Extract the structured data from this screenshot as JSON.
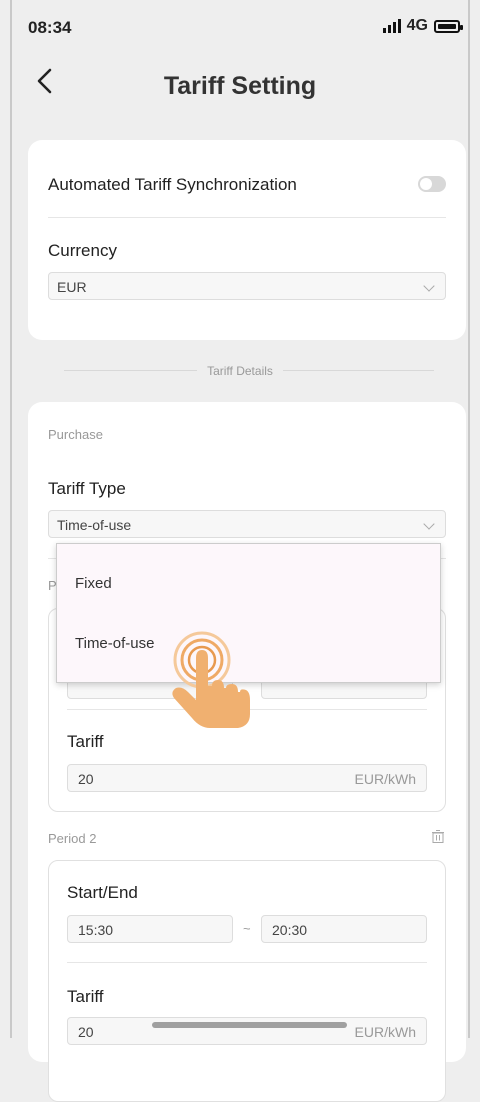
{
  "status_bar": {
    "time": "08:34",
    "network": "4G"
  },
  "header": {
    "back_icon": "chevron-left-icon",
    "title": "Tariff Setting"
  },
  "sync": {
    "label": "Automated Tariff Synchronization",
    "enabled": false
  },
  "currency": {
    "label": "Currency",
    "value": "EUR"
  },
  "section_label": "Tariff Details",
  "purchase": {
    "label": "Purchase",
    "tariff_type_label": "Tariff Type",
    "tariff_type_value": "Time-of-use",
    "period1_label_partial": "P",
    "period1": {
      "tariff_label": "Tariff",
      "tariff_value": "20",
      "unit": "EUR/kWh"
    },
    "period2": {
      "label": "Period 2",
      "start_end_label": "Start/End",
      "start": "15:30",
      "separator": "~",
      "end": "20:30",
      "tariff_label": "Tariff",
      "tariff_value": "20",
      "unit": "EUR/kWh"
    }
  },
  "dropdown": {
    "options": [
      "Fixed",
      "Time-of-use"
    ]
  },
  "colors": {
    "accent_hand": "#f0b070",
    "dropdown_bg": "#fdf7fb"
  }
}
